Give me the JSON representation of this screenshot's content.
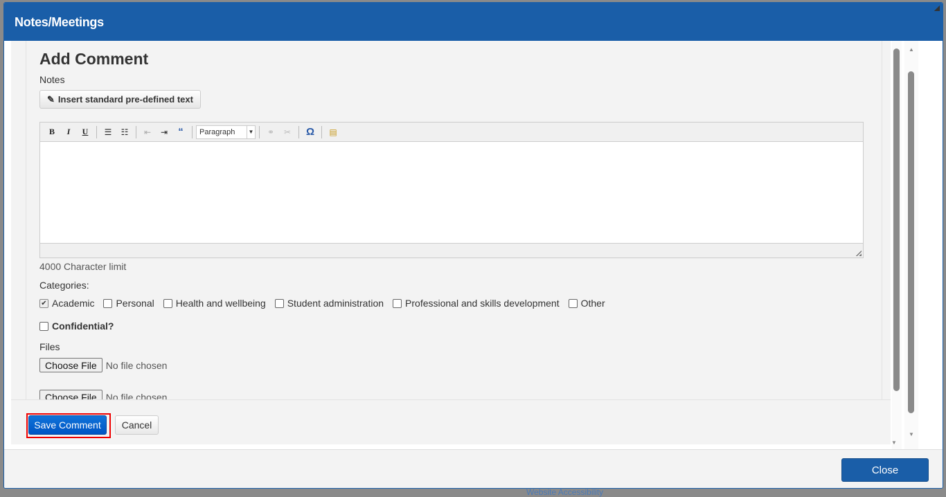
{
  "dialog": {
    "title": "Notes/Meetings",
    "close_label": "Close"
  },
  "form": {
    "heading": "Add Comment",
    "notes_label": "Notes",
    "insert_text_label": "Insert standard pre-defined text",
    "editor": {
      "format_selected": "Paragraph",
      "tools": [
        "bold",
        "italic",
        "underline",
        "bulleted-list",
        "numbered-list",
        "outdent",
        "indent",
        "blockquote",
        "format",
        "link",
        "unlink",
        "special-character",
        "paste-from-word"
      ]
    },
    "char_limit": "4000 Character limit",
    "categories_label": "Categories:",
    "categories": [
      {
        "label": "Academic",
        "checked": true
      },
      {
        "label": "Personal",
        "checked": false
      },
      {
        "label": "Health and wellbeing",
        "checked": false
      },
      {
        "label": "Student administration",
        "checked": false
      },
      {
        "label": "Professional and skills development",
        "checked": false
      },
      {
        "label": "Other",
        "checked": false
      }
    ],
    "confidential_label": "Confidential?",
    "files_label": "Files",
    "files": [
      {
        "button": "Choose File",
        "status": "No file chosen"
      },
      {
        "button": "Choose File",
        "status": "No file chosen"
      }
    ],
    "save_label": "Save Comment",
    "cancel_label": "Cancel"
  },
  "background": {
    "footer_link": "Website Accessibility"
  }
}
